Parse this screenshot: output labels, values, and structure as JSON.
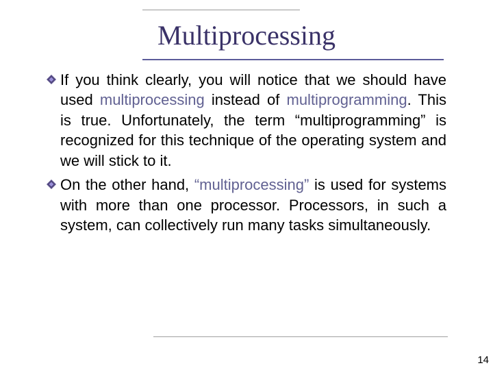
{
  "title": "Multiprocessing",
  "bullets": [
    {
      "pre": "If you think clearly, you will notice that we should have used ",
      "kw1": "multiprocessing",
      "mid": " instead of ",
      "kw2": "multiprogramming",
      "post": ". This is true. Unfortunately, the term “multiprogramming” is recognized for this technique of the operating system and we will stick to it."
    },
    {
      "pre": "On the other hand, ",
      "kw1": "“multiprocessing”",
      "mid": "",
      "kw2": "",
      "post": " is used for systems with more than one processor. Processors, in such a system, can collectively run many tasks simultaneously."
    }
  ],
  "page_number": "14"
}
